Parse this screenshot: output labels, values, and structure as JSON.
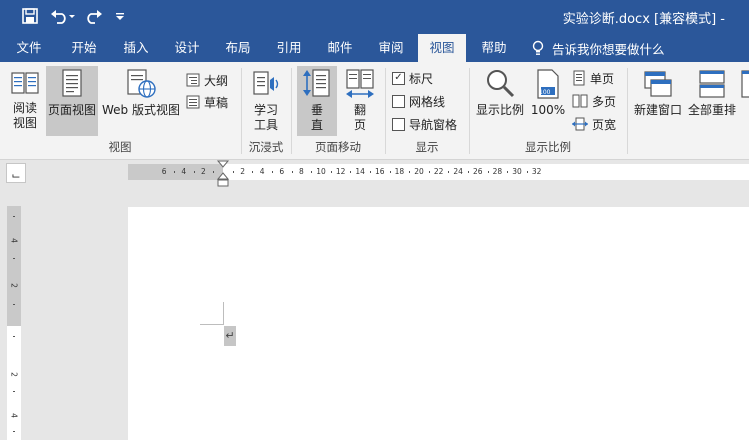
{
  "window": {
    "title": "实验诊断.docx [兼容模式] -"
  },
  "quick_access": {
    "save_icon": "save-icon",
    "undo_icon": "undo-icon",
    "redo_icon": "redo-icon",
    "customize_icon": "customize-qat-icon"
  },
  "tabs": [
    {
      "label": "文件"
    },
    {
      "label": "开始"
    },
    {
      "label": "插入"
    },
    {
      "label": "设计"
    },
    {
      "label": "布局"
    },
    {
      "label": "引用"
    },
    {
      "label": "邮件"
    },
    {
      "label": "审阅"
    },
    {
      "label": "视图"
    },
    {
      "label": "帮助"
    }
  ],
  "active_tab": "视图",
  "tell_me": {
    "label": "告诉我你想要做什么"
  },
  "ribbon": {
    "views": {
      "group_label": "视图",
      "read_mode": {
        "line1": "阅读",
        "line2": "视图"
      },
      "print_layout": {
        "label": "页面视图"
      },
      "web_layout": {
        "label": "Web 版式视图"
      },
      "outline": {
        "label": "大纲"
      },
      "draft": {
        "label": "草稿"
      }
    },
    "immersive": {
      "group_label": "沉浸式",
      "learning_tools": {
        "line1": "学习",
        "line2": "工具"
      }
    },
    "page_movement": {
      "group_label": "页面移动",
      "vertical": {
        "line1": "垂",
        "line2": "直"
      },
      "side_to_side": {
        "line1": "翻",
        "line2": "页"
      }
    },
    "show": {
      "group_label": "显示",
      "ruler": {
        "label": "标尺",
        "checked": true
      },
      "gridlines": {
        "label": "网格线",
        "checked": false
      },
      "nav_pane": {
        "label": "导航窗格",
        "checked": false
      }
    },
    "zoom": {
      "group_label": "显示比例",
      "zoom": {
        "label": "显示比例"
      },
      "hundred": {
        "label": "100%",
        "icon_text": "100"
      },
      "one_page": {
        "label": "单页"
      },
      "multiple_pages": {
        "label": "多页"
      },
      "page_width": {
        "label": "页宽"
      }
    },
    "window": {
      "new_window": {
        "label": "新建窗口"
      },
      "arrange_all": {
        "label": "全部重排"
      }
    }
  },
  "ruler": {
    "tab_selector": "⌙",
    "h_ticks_left": [
      "6",
      "4",
      "2"
    ],
    "h_ticks_right": [
      "2",
      "4",
      "6",
      "8",
      "10",
      "12",
      "14",
      "16",
      "18",
      "20",
      "22",
      "24",
      "26",
      "28",
      "30",
      "32"
    ],
    "v_ticks": [
      "4",
      "2",
      "2",
      "4"
    ]
  },
  "document": {
    "paragraph_mark": "↵"
  },
  "colors": {
    "accent": "#2b579a",
    "ribbon_bg": "#f3f3f3",
    "pressed": "#c8c8c8",
    "icon_blue": "#2e6fbf"
  }
}
